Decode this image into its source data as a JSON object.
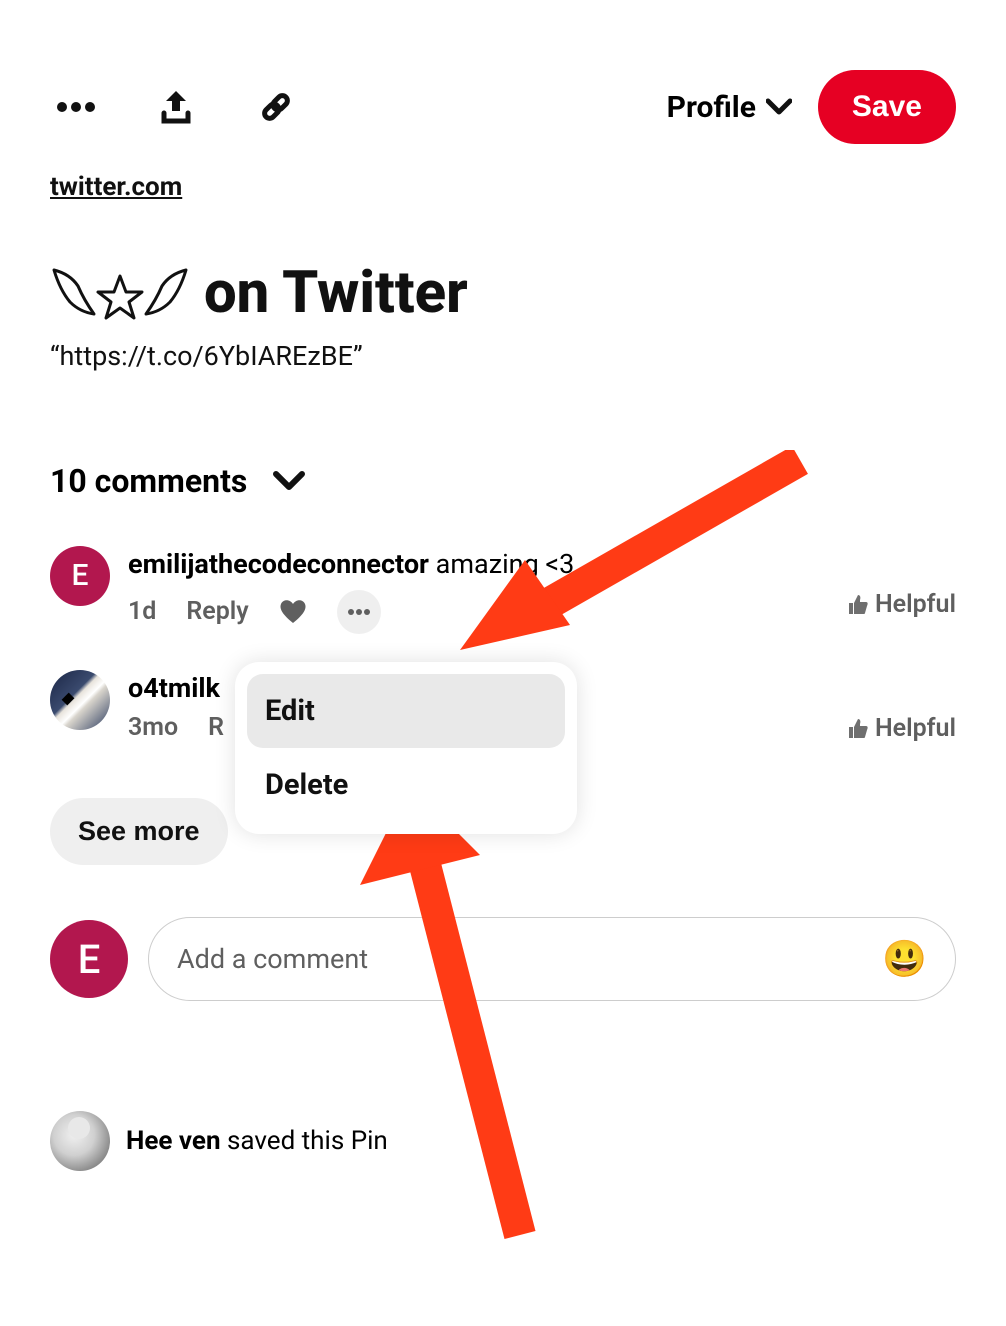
{
  "toolbar": {
    "board_label": "Profile",
    "save_label": "Save"
  },
  "source": {
    "link_text": "twitter.com"
  },
  "pin": {
    "title_text": "on Twitter",
    "description": "“https://t.co/6YbIAREzBE”"
  },
  "comments": {
    "header": "10 comments",
    "see_more": "See more",
    "items": [
      {
        "avatar_letter": "E",
        "username": "emilijathecodeconnector",
        "text": "amazing <3",
        "time": "1d",
        "reply": "Reply",
        "helpful": "Helpful"
      },
      {
        "username": "o4tmilk",
        "text": "",
        "time": "3mo",
        "reply": "R",
        "helpful": "Helpful"
      }
    ]
  },
  "dropdown": {
    "edit": "Edit",
    "delete": "Delete"
  },
  "composer": {
    "avatar_letter": "E",
    "placeholder": "Add a comment"
  },
  "saved_by": {
    "name": "Hee ven",
    "suffix": " saved this Pin"
  },
  "colors": {
    "accent": "#e60023",
    "arrow": "#ff3b15"
  }
}
